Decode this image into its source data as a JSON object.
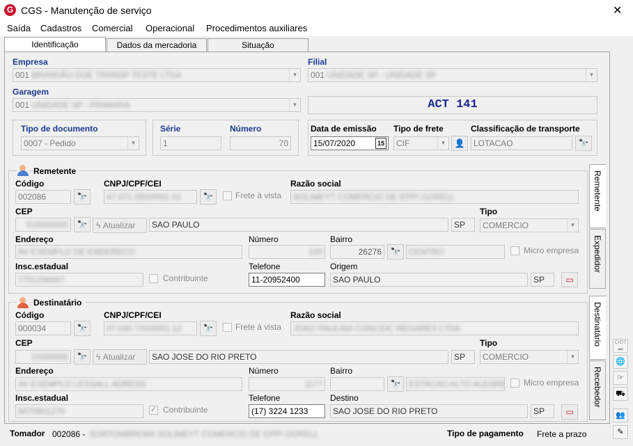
{
  "window": {
    "title": "CGS - Manutenção de serviço",
    "close": "✕",
    "logo": "G"
  },
  "menu": [
    "Saída",
    "Cadastros",
    "Comercial",
    "Operacional",
    "Procedimentos auxiliares"
  ],
  "tabs": [
    "Identificação",
    "Dados da mercadoria",
    "Situação"
  ],
  "ident": {
    "empresa_label": "Empresa",
    "empresa_code": "001",
    "empresa_name": "BRANDÃO DOE TRANSP TESTE LTDA",
    "filial_label": "Filial",
    "filial_code": "001",
    "filial_name": "UNIDADE SP - UNIDADE SP",
    "garagem_label": "Garagem",
    "garagem_code": "001",
    "garagem_name": "UNIDADE SP - PRIMARIA",
    "act": "ACT 141",
    "tipo_doc_label": "Tipo de documento",
    "tipo_doc_value": "0007 - Pedido",
    "serie_label": "Série",
    "serie_value": "1",
    "numero_label": "Número",
    "numero_value": "70",
    "data_label": "Data de emissão",
    "data_value": "15/07/2020",
    "cal_icon": "15",
    "frete_label": "Tipo de frete",
    "frete_value": "CIF",
    "class_label": "Classificação de transporte",
    "class_value": "LOTACAO"
  },
  "remetente": {
    "title": "Remetente",
    "codigo_label": "Código",
    "codigo_value": "002086",
    "cnpj_label": "CNPJ/CPF/CEI",
    "cnpj_value": "47.071.050/0001-51",
    "frete_vista": "Frete à vista",
    "razao_label": "Razão social",
    "razao_value": "SOLIMEYT COMERCIO DE EPPI GORELL",
    "cep_label": "CEP",
    "cep_value": "010000000",
    "atualizar": "Atualizar",
    "cidade": "SAO PAULO",
    "uf": "SP",
    "tipo_label": "Tipo",
    "tipo_value": "COMERCIO",
    "endereco_label": "Endereço",
    "endereco_value": "AV EXEMPLO DE ENDERECO",
    "numero_label": "Número",
    "numero_value": "100",
    "bairro_label": "Bairro",
    "bairro_code": "26276",
    "bairro_name": "CENTRO",
    "micro": "Micro empresa",
    "insc_label": "Insc.estadual",
    "insc_value": "7701234567",
    "contribuinte": "Contribuinte",
    "tel_label": "Telefone",
    "tel_value": "11-20952400",
    "origem_label": "Origem",
    "origem_value": "SAO PAULO",
    "origem_uf": "SP"
  },
  "destinatario": {
    "title": "Destinatário",
    "codigo_label": "Código",
    "codigo_value": "000034",
    "cnpj_label": "CNPJ/CPF/CEI",
    "cnpj_value": "07.040.720/0001-12",
    "frete_vista": "Frete à vista",
    "razao_label": "Razão social",
    "razao_value": "JOAO PAULINA CONCEIC REGARES LTDA",
    "cep_label": "CEP",
    "cep_value": "15000000",
    "atualizar": "Atualizar",
    "cidade": "SAO JOSE DO RIO PRETO",
    "uf": "SP",
    "tipo_label": "Tipo",
    "tipo_value": "COMERCIO",
    "endereco_label": "Endereço",
    "endereco_value": "AV EXEMPLO LESSALL ADRESS",
    "numero_label": "Número",
    "numero_value": "1177",
    "bairro_label": "Bairro",
    "bairro_code": "",
    "bairro_name": "ESTACAO ALTO ALEGRE",
    "micro": "Micro empresa",
    "insc_label": "Insc.estadual",
    "insc_value": "6470801270",
    "contribuinte": "Contribuinte",
    "tel_label": "Telefone",
    "tel_value": "(17) 3224 1233",
    "destino_label": "Destino",
    "destino_value": "SAO JOSE DO RIO PRETO",
    "destino_uf": "SP"
  },
  "side_tabs": [
    "Remetente",
    "Expedidor",
    "Destinatário",
    "Recebedor"
  ],
  "footer": {
    "tomador_label": "Tomador",
    "tomador_code": "002086 -",
    "tomador_name": "SORTOMBREMA SOLIMEYT COMERCIO DE EPPI GORELL",
    "pag_label": "Tipo de pagamento",
    "pag_value": "Frete a prazo"
  }
}
